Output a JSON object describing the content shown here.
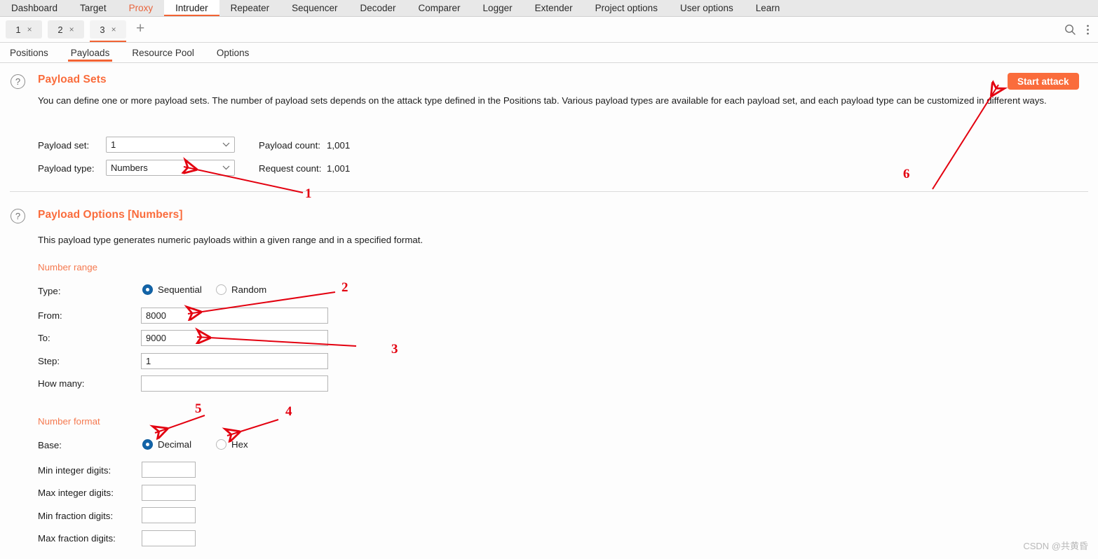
{
  "main_tabs": [
    {
      "label": "Dashboard",
      "state": "normal"
    },
    {
      "label": "Target",
      "state": "normal"
    },
    {
      "label": "Proxy",
      "state": "highlight"
    },
    {
      "label": "Intruder",
      "state": "active"
    },
    {
      "label": "Repeater",
      "state": "normal"
    },
    {
      "label": "Sequencer",
      "state": "normal"
    },
    {
      "label": "Decoder",
      "state": "normal"
    },
    {
      "label": "Comparer",
      "state": "normal"
    },
    {
      "label": "Logger",
      "state": "normal"
    },
    {
      "label": "Extender",
      "state": "normal"
    },
    {
      "label": "Project options",
      "state": "normal"
    },
    {
      "label": "User options",
      "state": "normal"
    },
    {
      "label": "Learn",
      "state": "normal"
    }
  ],
  "attack_tabs": [
    {
      "label": "1",
      "close": "×",
      "active": false
    },
    {
      "label": "2",
      "close": "×",
      "active": false
    },
    {
      "label": "3",
      "close": "×",
      "active": true
    }
  ],
  "attack_tabs_add": "+",
  "strip_icons": {
    "search": "search-icon",
    "menu": "more-vertical-icon"
  },
  "sub_tabs": [
    {
      "label": "Positions",
      "active": false
    },
    {
      "label": "Payloads",
      "active": true
    },
    {
      "label": "Resource Pool",
      "active": false
    },
    {
      "label": "Options",
      "active": false
    }
  ],
  "payload_sets": {
    "help": "?",
    "title": "Payload Sets",
    "description": "You can define one or more payload sets. The number of payload sets depends on the attack type defined in the Positions tab. Various payload types are available for each payload set, and each payload type can be customized in different ways.",
    "payload_set_label": "Payload set:",
    "payload_set_value": "1",
    "payload_type_label": "Payload type:",
    "payload_type_value": "Numbers",
    "payload_count_label": "Payload count:",
    "payload_count_value": "1,001",
    "request_count_label": "Request count:",
    "request_count_value": "1,001",
    "start_attack_label": "Start attack"
  },
  "payload_options": {
    "help": "?",
    "title": "Payload Options [Numbers]",
    "description": "This payload type generates numeric payloads within a given range and in a specified format.",
    "number_range_heading": "Number range",
    "type_label": "Type:",
    "type_options": [
      {
        "label": "Sequential",
        "selected": true
      },
      {
        "label": "Random",
        "selected": false
      }
    ],
    "fields": [
      {
        "label": "From:",
        "value": "8000"
      },
      {
        "label": "To:",
        "value": "9000"
      },
      {
        "label": "Step:",
        "value": "1"
      },
      {
        "label": "How many:",
        "value": ""
      }
    ],
    "number_format_heading": "Number format",
    "base_label": "Base:",
    "base_options": [
      {
        "label": "Decimal",
        "selected": true
      },
      {
        "label": "Hex",
        "selected": false
      }
    ],
    "digit_fields": [
      {
        "label": "Min integer digits:",
        "value": ""
      },
      {
        "label": "Max integer digits:",
        "value": ""
      },
      {
        "label": "Min fraction digits:",
        "value": ""
      },
      {
        "label": "Max fraction digits:",
        "value": ""
      }
    ]
  },
  "annotations": [
    {
      "number": "1"
    },
    {
      "number": "2"
    },
    {
      "number": "3"
    },
    {
      "number": "4"
    },
    {
      "number": "5"
    },
    {
      "number": "6"
    }
  ],
  "watermark": "CSDN @共黄昏",
  "colors": {
    "accent_orange": "#fa6c3c",
    "tab_underline": "#f26334",
    "radio_selected": "#1364a8",
    "annotation_red": "#e3000f"
  }
}
